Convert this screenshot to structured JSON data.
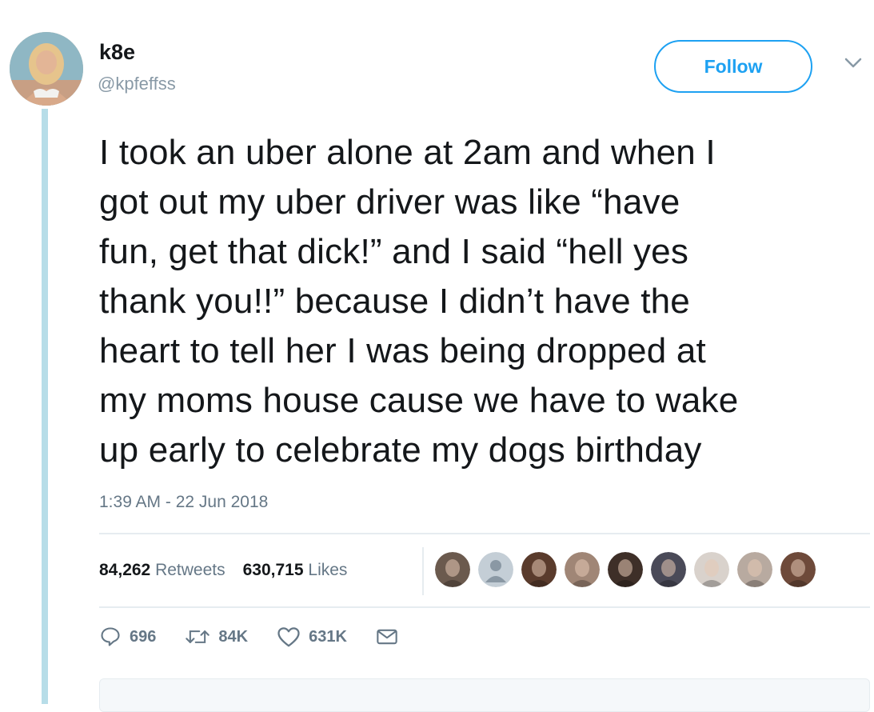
{
  "user": {
    "display_name": "k8e",
    "username": "@kpfeffss"
  },
  "follow_label": "Follow",
  "tweet": {
    "text": "I took an uber alone at 2am and when I\ngot out my uber driver was like “have\nfun, get that dick!” and I said “hell yes\nthank you!!” because I didn’t have the\nheart to tell her I was being dropped at\nmy moms house cause we have to wake\nup early to celebrate my dogs birthday",
    "timestamp": "1:39 AM - 22 Jun 2018"
  },
  "stats": {
    "retweets_count": "84,262",
    "retweets_label": "Retweets",
    "likes_count": "630,715",
    "likes_label": "Likes"
  },
  "likers": [
    {
      "icon": "liker-avatar-1",
      "color": "#6b5a4e"
    },
    {
      "icon": "default-avatar-icon",
      "color": "#c4ced6"
    },
    {
      "icon": "liker-avatar-3",
      "color": "#5a3b2c"
    },
    {
      "icon": "liker-avatar-4",
      "color": "#a08676"
    },
    {
      "icon": "liker-avatar-5",
      "color": "#3e2f28"
    },
    {
      "icon": "liker-avatar-6",
      "color": "#4a4a58"
    },
    {
      "icon": "liker-avatar-7",
      "color": "#d9d2cc"
    },
    {
      "icon": "liker-avatar-8",
      "color": "#b8aaa0"
    },
    {
      "icon": "liker-avatar-9",
      "color": "#6e4a3a"
    }
  ],
  "actions": {
    "replies": "696",
    "retweets": "84K",
    "likes": "631K"
  },
  "colors": {
    "accent": "#1da1f2",
    "muted": "#657786",
    "thread_line": "#b7dde8"
  }
}
